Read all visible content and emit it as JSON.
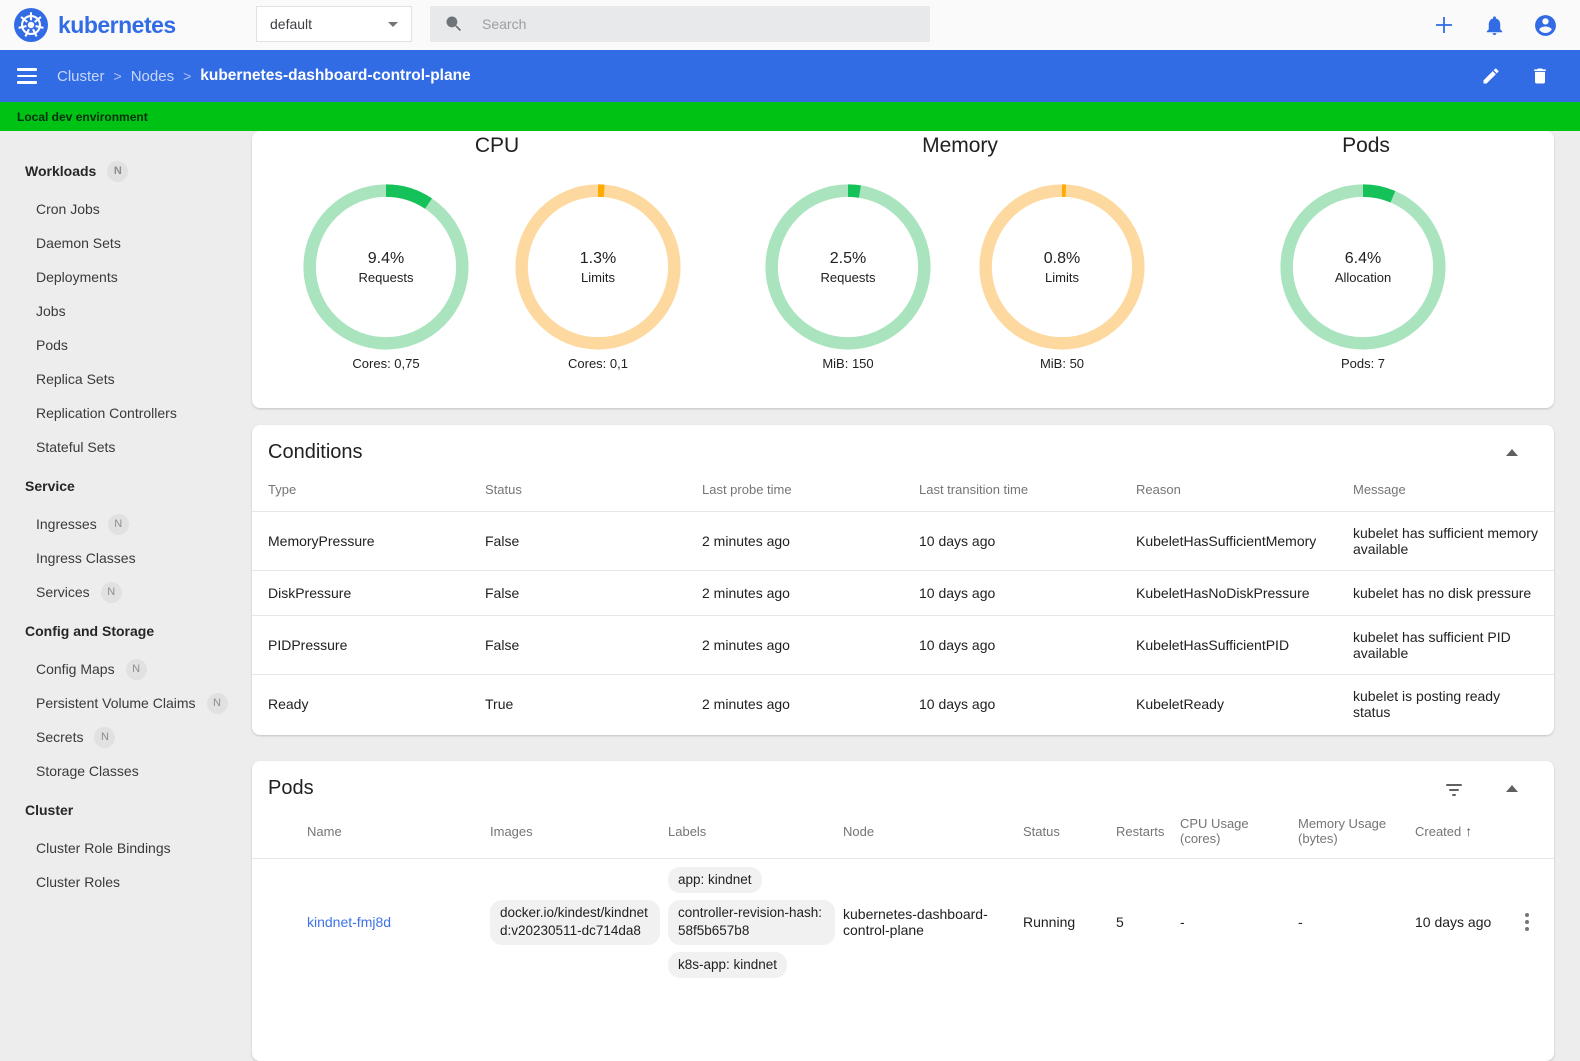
{
  "colors": {
    "brand_blue": "#326ce5",
    "banner_green": "#00c214",
    "gauge_green": "#15c159",
    "gauge_green_light": "#a9e4be",
    "gauge_orange": "#ffaa01",
    "gauge_orange_light": "#fdd9a0",
    "link_blue": "#3e73e8",
    "status_running_green": "#1a9c0d"
  },
  "icons": {
    "logo": "kubernetes-helm-wheel",
    "dropdown": "caret-down",
    "search": "magnifier",
    "add": "plus",
    "notifications": "bell",
    "account": "person-circle",
    "menu": "hamburger",
    "edit": "pencil",
    "delete": "trash",
    "collapse": "triangle-up",
    "filter": "filter-lines",
    "sort_asc": "↑",
    "more": "kebab-dots"
  },
  "topbar": {
    "brand": "kubernetes",
    "namespace_value": "default",
    "search_placeholder": "Search"
  },
  "breadcrumb": {
    "part1": "Cluster",
    "part2": "Nodes",
    "separator": ">",
    "current": "kubernetes-dashboard-control-plane"
  },
  "banner": {
    "text": "Local dev environment"
  },
  "sidebar": {
    "sections": [
      {
        "label": "Workloads",
        "badge": "N",
        "items": [
          {
            "label": "Cron Jobs"
          },
          {
            "label": "Daemon Sets"
          },
          {
            "label": "Deployments"
          },
          {
            "label": "Jobs"
          },
          {
            "label": "Pods"
          },
          {
            "label": "Replica Sets"
          },
          {
            "label": "Replication Controllers"
          },
          {
            "label": "Stateful Sets"
          }
        ]
      },
      {
        "label": "Service",
        "items": [
          {
            "label": "Ingresses",
            "badge": "N"
          },
          {
            "label": "Ingress Classes"
          },
          {
            "label": "Services",
            "badge": "N"
          }
        ]
      },
      {
        "label": "Config and Storage",
        "items": [
          {
            "label": "Config Maps",
            "badge": "N"
          },
          {
            "label": "Persistent Volume Claims",
            "badge": "N"
          },
          {
            "label": "Secrets",
            "badge": "N"
          },
          {
            "label": "Storage Classes"
          }
        ]
      },
      {
        "label": "Cluster",
        "items": [
          {
            "label": "Cluster Role Bindings"
          },
          {
            "label": "Cluster Roles"
          }
        ]
      }
    ]
  },
  "chart_data": {
    "type": "donut-gauges",
    "groups": [
      {
        "title": "CPU",
        "charts": [
          {
            "percent": 9.4,
            "percent_label": "9.4%",
            "label": "Requests",
            "caption": "Cores: 0,75",
            "color": "green"
          },
          {
            "percent": 1.3,
            "percent_label": "1.3%",
            "label": "Limits",
            "caption": "Cores: 0,1",
            "color": "orange"
          }
        ]
      },
      {
        "title": "Memory",
        "charts": [
          {
            "percent": 2.5,
            "percent_label": "2.5%",
            "label": "Requests",
            "caption": "MiB: 150",
            "color": "green"
          },
          {
            "percent": 0.8,
            "percent_label": "0.8%",
            "label": "Limits",
            "caption": "MiB: 50",
            "color": "orange"
          }
        ]
      },
      {
        "title": "Pods",
        "charts": [
          {
            "percent": 6.4,
            "percent_label": "6.4%",
            "label": "Allocation",
            "caption": "Pods: 7",
            "color": "green"
          }
        ]
      }
    ]
  },
  "conditions": {
    "title": "Conditions",
    "columns": [
      "Type",
      "Status",
      "Last probe time",
      "Last transition time",
      "Reason",
      "Message"
    ],
    "rows": [
      {
        "type": "MemoryPressure",
        "status": "False",
        "probe": "2 minutes ago",
        "transition": "10 days ago",
        "reason": "KubeletHasSufficientMemory",
        "message": "kubelet has sufficient memory available"
      },
      {
        "type": "DiskPressure",
        "status": "False",
        "probe": "2 minutes ago",
        "transition": "10 days ago",
        "reason": "KubeletHasNoDiskPressure",
        "message": "kubelet has no disk pressure"
      },
      {
        "type": "PIDPressure",
        "status": "False",
        "probe": "2 minutes ago",
        "transition": "10 days ago",
        "reason": "KubeletHasSufficientPID",
        "message": "kubelet has sufficient PID available"
      },
      {
        "type": "Ready",
        "status": "True",
        "probe": "2 minutes ago",
        "transition": "10 days ago",
        "reason": "KubeletReady",
        "message": "kubelet is posting ready status"
      }
    ]
  },
  "pods": {
    "title": "Pods",
    "columns": [
      "Name",
      "Images",
      "Labels",
      "Node",
      "Status",
      "Restarts",
      "CPU Usage (cores)",
      "Memory Usage (bytes)",
      "Created"
    ],
    "sort": {
      "column": "Created",
      "direction": "asc",
      "arrow": "↑"
    },
    "rows": [
      {
        "status_indicator": "running-green",
        "name": "kindnet-fmj8d",
        "image": "docker.io/kindest/kindnetd:v20230511-dc714da8",
        "labels": [
          "app: kindnet",
          "controller-revision-hash: 58f5b657b8",
          "k8s-app: kindnet"
        ],
        "node": "kubernetes-dashboard-control-plane",
        "status": "Running",
        "restarts": "5",
        "cpu_usage": "-",
        "memory_usage": "-",
        "created": "10 days ago"
      }
    ]
  }
}
